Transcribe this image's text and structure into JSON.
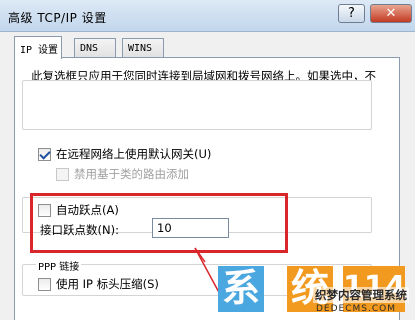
{
  "window": {
    "title": "高级 TCP/IP 设置",
    "help_label": "?",
    "close_label": "✕"
  },
  "tabs": [
    {
      "label": "IP 设置",
      "active": true
    },
    {
      "label": "DNS",
      "active": false
    },
    {
      "label": "WINS",
      "active": false
    }
  ],
  "description": "此复选框只应用于您同时连接到局域网和拨号网络上。如果选中，不能发送到局域网上的数据将被转发到拨号网络上。",
  "options": {
    "default_gateway": {
      "label": "在远程网络上使用默认网关(U)",
      "checked": true
    },
    "class_route": {
      "label": "禁用基于类的路由添加",
      "checked": false,
      "disabled": true
    },
    "auto_metric": {
      "label": "自动跃点(A)",
      "checked": false
    },
    "interface_metric": {
      "label": "接口跃点数(N):",
      "value": "10"
    }
  },
  "ppp": {
    "group_label": "PPP 链接",
    "header_compression": {
      "label": "使用 IP 标头压缩(S)",
      "checked": false
    }
  },
  "watermark": {
    "char1": "系",
    "char2": "统",
    "char3": "114",
    "line1": "织梦内容管理系统",
    "line2": "DEDECMS.COM"
  },
  "colors": {
    "highlight": "#d9262b",
    "watermark_blue": "#4aa7e0",
    "watermark_orange": "#f29a1f"
  }
}
